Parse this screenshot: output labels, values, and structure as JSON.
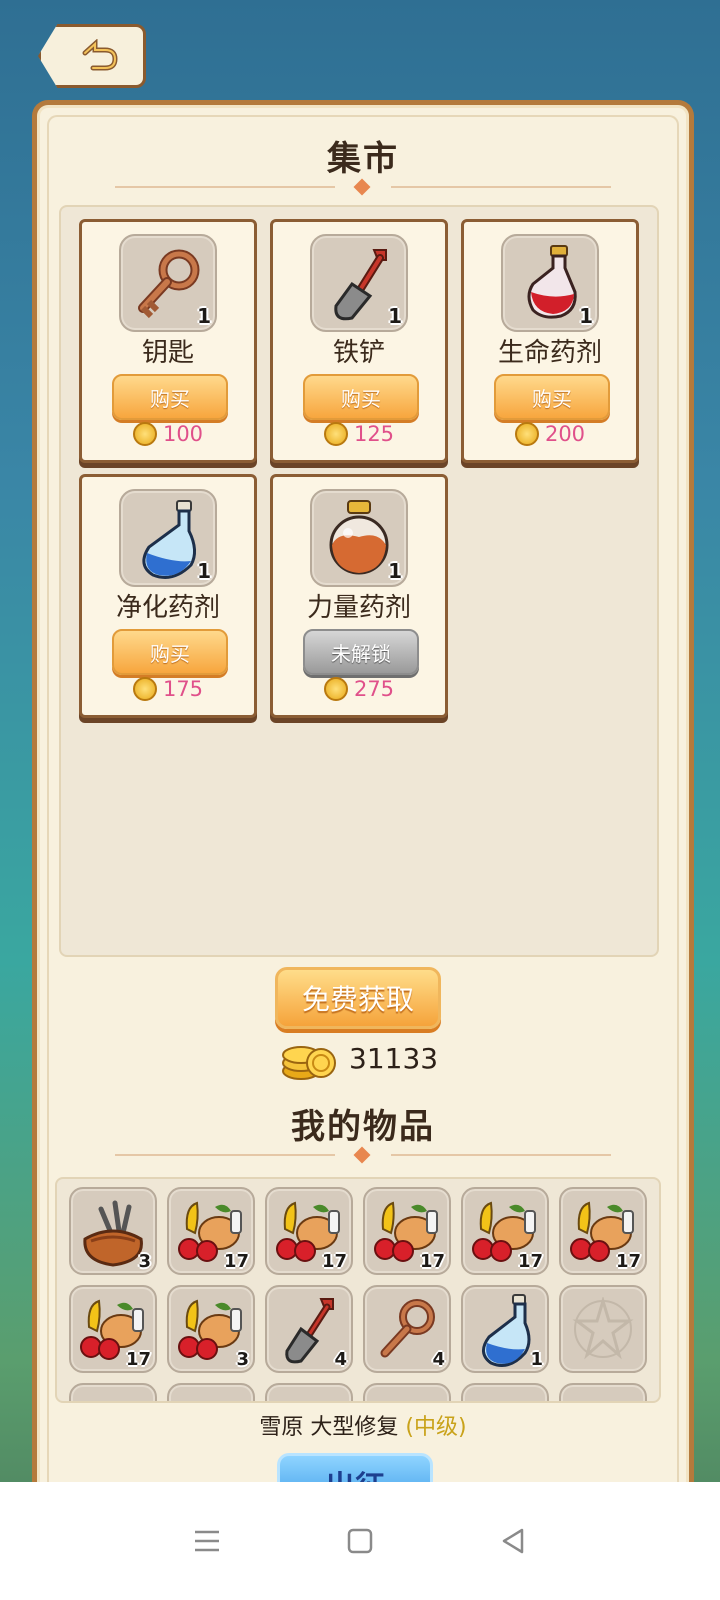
{
  "shop": {
    "title": "集市",
    "items": [
      {
        "name": "钥匙",
        "icon": "key-icon",
        "qty": "1",
        "button": "购买",
        "price": "100",
        "locked": false
      },
      {
        "name": "铁铲",
        "icon": "shovel-icon",
        "qty": "1",
        "button": "购买",
        "price": "125",
        "locked": false
      },
      {
        "name": "生命药剂",
        "icon": "red-potion-icon",
        "qty": "1",
        "button": "购买",
        "price": "200",
        "locked": false
      },
      {
        "name": "净化药剂",
        "icon": "blue-potion-icon",
        "qty": "1",
        "button": "购买",
        "price": "175",
        "locked": false
      },
      {
        "name": "力量药剂",
        "icon": "strength-potion-icon",
        "qty": "1",
        "button": "未解锁",
        "price": "275",
        "locked": true
      }
    ],
    "free_button": "免费获取",
    "gold_amount": "31133"
  },
  "inventory": {
    "title": "我的物品",
    "slots": [
      {
        "icon": "tool-bag-icon",
        "qty": "3"
      },
      {
        "icon": "food-basket-icon",
        "qty": "17"
      },
      {
        "icon": "food-basket-icon",
        "qty": "17"
      },
      {
        "icon": "food-basket-icon",
        "qty": "17"
      },
      {
        "icon": "food-basket-icon",
        "qty": "17"
      },
      {
        "icon": "food-basket-icon",
        "qty": "17"
      },
      {
        "icon": "food-basket-icon",
        "qty": "17"
      },
      {
        "icon": "food-basket-icon",
        "qty": "3"
      },
      {
        "icon": "shovel-icon",
        "qty": "4"
      },
      {
        "icon": "key-icon",
        "qty": "4"
      },
      {
        "icon": "blue-potion-icon",
        "qty": "1"
      },
      {
        "icon": "empty-slot-icon",
        "qty": ""
      }
    ]
  },
  "mission": {
    "text": "雪原 大型修复",
    "level": "(中级)",
    "go_button": "出征"
  },
  "colors": {
    "panel_border": "#b47a3c",
    "buy_button": "#f7a63e",
    "price_text": "#e0508a",
    "level_text": "#c9a21a"
  }
}
